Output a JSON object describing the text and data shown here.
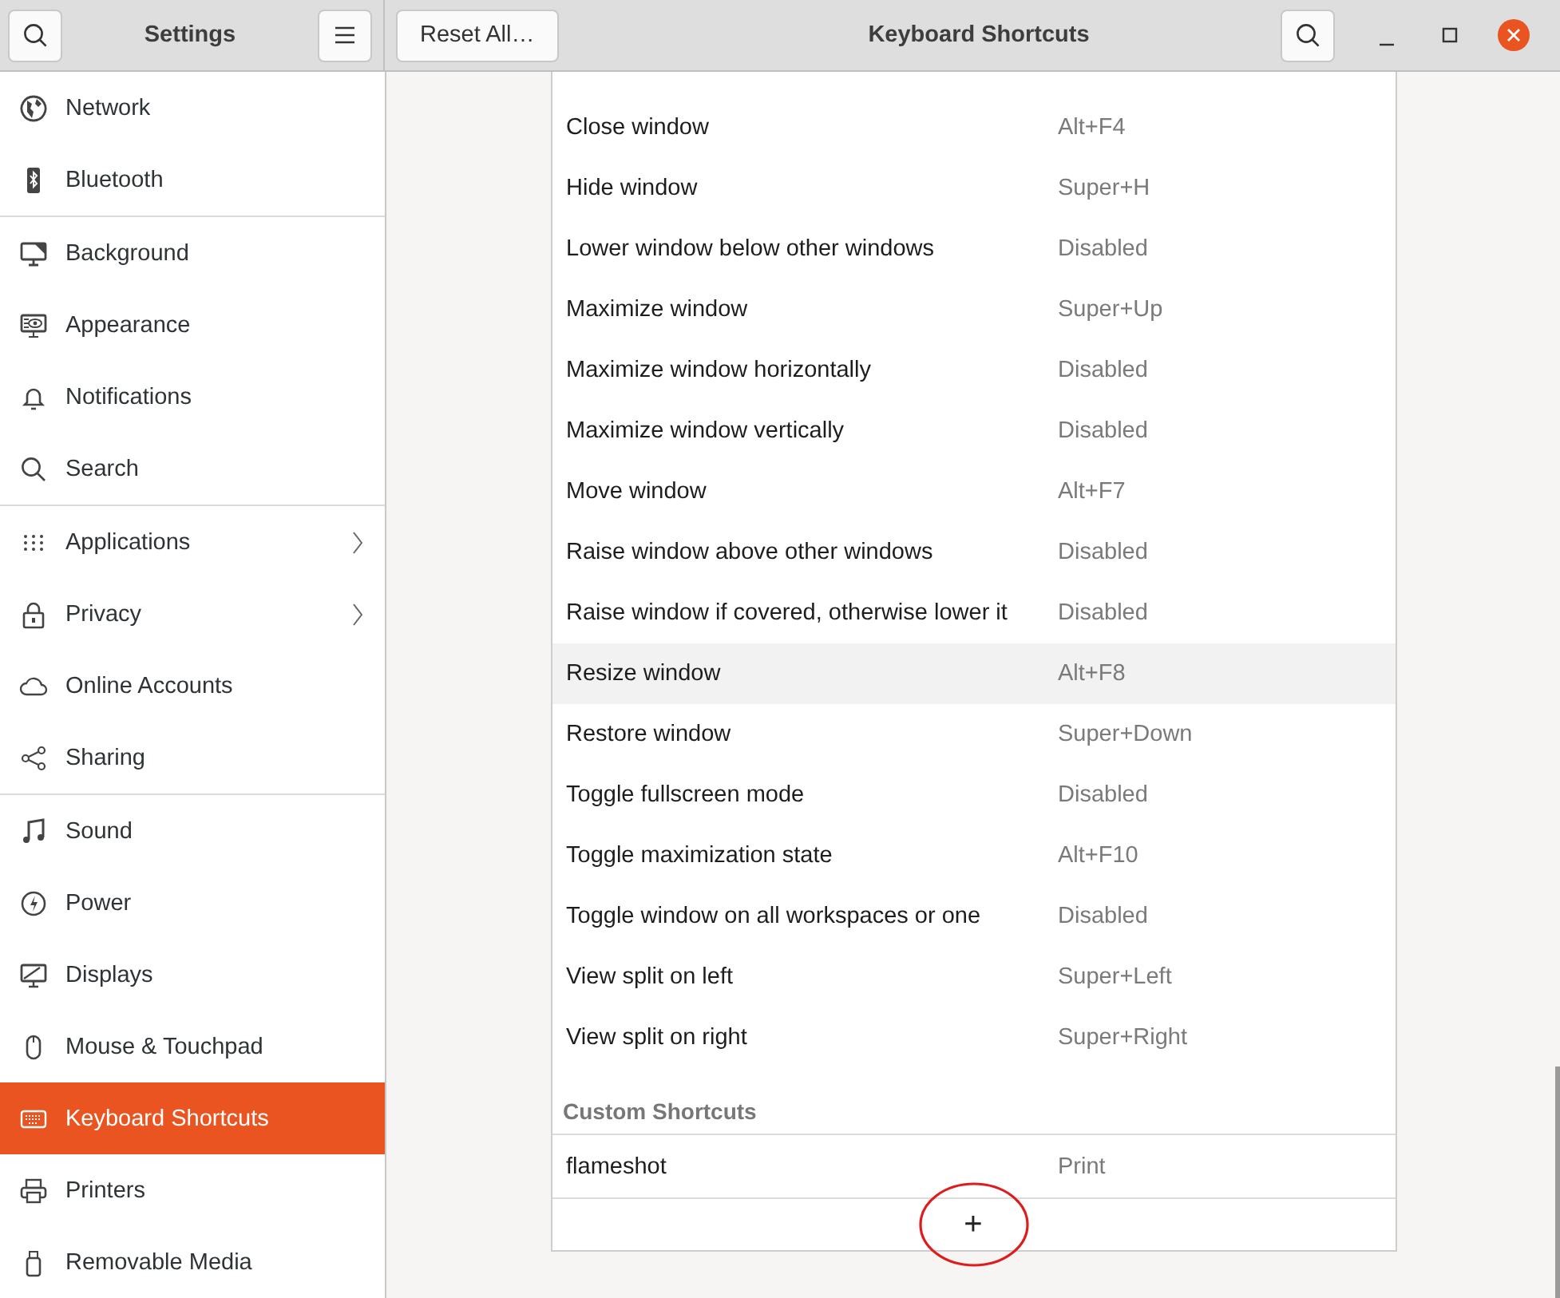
{
  "window": {
    "title": "Settings",
    "page_title": "Keyboard Shortcuts"
  },
  "header": {
    "reset_button": "Reset All…"
  },
  "sidebar": {
    "groups": [
      [
        {
          "label": "Network",
          "selected": false,
          "has_submenu": false
        },
        {
          "label": "Bluetooth",
          "selected": false,
          "has_submenu": false
        }
      ],
      [
        {
          "label": "Background",
          "selected": false,
          "has_submenu": false
        },
        {
          "label": "Appearance",
          "selected": false,
          "has_submenu": false
        },
        {
          "label": "Notifications",
          "selected": false,
          "has_submenu": false
        },
        {
          "label": "Search",
          "selected": false,
          "has_submenu": false
        }
      ],
      [
        {
          "label": "Applications",
          "selected": false,
          "has_submenu": true
        },
        {
          "label": "Privacy",
          "selected": false,
          "has_submenu": true
        },
        {
          "label": "Online Accounts",
          "selected": false,
          "has_submenu": false
        },
        {
          "label": "Sharing",
          "selected": false,
          "has_submenu": false
        }
      ],
      [
        {
          "label": "Sound",
          "selected": false,
          "has_submenu": false
        },
        {
          "label": "Power",
          "selected": false,
          "has_submenu": false
        },
        {
          "label": "Displays",
          "selected": false,
          "has_submenu": false
        },
        {
          "label": "Mouse & Touchpad",
          "selected": false,
          "has_submenu": false
        },
        {
          "label": "Keyboard Shortcuts",
          "selected": true,
          "has_submenu": false
        },
        {
          "label": "Printers",
          "selected": false,
          "has_submenu": false
        },
        {
          "label": "Removable Media",
          "selected": false,
          "has_submenu": false
        }
      ]
    ]
  },
  "shortcuts": [
    {
      "name": "Close window",
      "accel": "Alt+F4",
      "highlighted": false
    },
    {
      "name": "Hide window",
      "accel": "Super+H",
      "highlighted": false
    },
    {
      "name": "Lower window below other windows",
      "accel": "Disabled",
      "highlighted": false
    },
    {
      "name": "Maximize window",
      "accel": "Super+Up",
      "highlighted": false
    },
    {
      "name": "Maximize window horizontally",
      "accel": "Disabled",
      "highlighted": false
    },
    {
      "name": "Maximize window vertically",
      "accel": "Disabled",
      "highlighted": false
    },
    {
      "name": "Move window",
      "accel": "Alt+F7",
      "highlighted": false
    },
    {
      "name": "Raise window above other windows",
      "accel": "Disabled",
      "highlighted": false
    },
    {
      "name": "Raise window if covered, otherwise lower it",
      "accel": "Disabled",
      "highlighted": false
    },
    {
      "name": "Resize window",
      "accel": "Alt+F8",
      "highlighted": true
    },
    {
      "name": "Restore window",
      "accel": "Super+Down",
      "highlighted": false
    },
    {
      "name": "Toggle fullscreen mode",
      "accel": "Disabled",
      "highlighted": false
    },
    {
      "name": "Toggle maximization state",
      "accel": "Alt+F10",
      "highlighted": false
    },
    {
      "name": "Toggle window on all workspaces or one",
      "accel": "Disabled",
      "highlighted": false
    },
    {
      "name": "View split on left",
      "accel": "Super+Left",
      "highlighted": false
    },
    {
      "name": "View split on right",
      "accel": "Super+Right",
      "highlighted": false
    }
  ],
  "custom": {
    "title": "Custom Shortcuts",
    "rows": [
      {
        "name": "flameshot",
        "accel": "Print",
        "highlighted": false
      }
    ],
    "add_button": "+"
  }
}
